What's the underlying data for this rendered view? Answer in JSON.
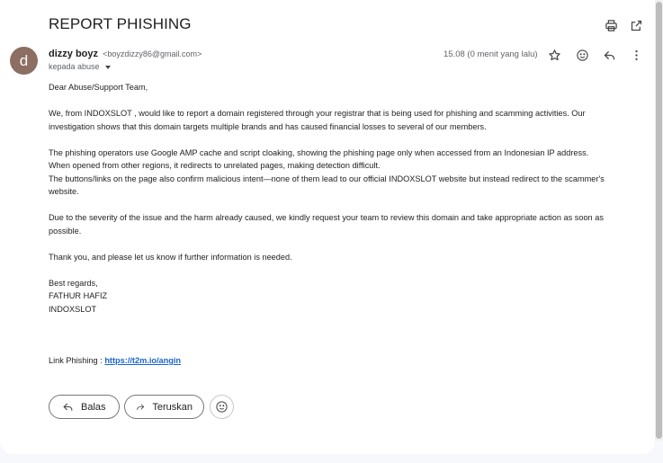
{
  "email": {
    "subject": "REPORT PHISHING",
    "sender": {
      "avatar_letter": "d",
      "name": "dizzy boyz",
      "email": "<boyzdizzy86@gmail.com>",
      "to_label": "kepada abuse"
    },
    "timestamp": "15.08 (0 menit yang lalu)",
    "body": {
      "greeting": "Dear Abuse/Support Team,",
      "p1": [
        "We, from INDOXSLOT , would like to report a domain registered through your registrar that is being used for phishing and scamming activities. Our",
        "investigation shows that this domain targets multiple brands and has caused financial losses to several of our members."
      ],
      "p2": [
        "The phishing operators use Google AMP cache and script cloaking, showing the phishing page only when accessed from an Indonesian IP address.",
        "When opened from other regions, it redirects to unrelated pages, making detection difficult.",
        "The buttons/links on the page also confirm malicious intent—none of them lead to our official INDOXSLOT website but instead redirect to the scammer's",
        "website."
      ],
      "p3": [
        "Due to the severity of the issue and the harm already caused, we kindly request your team to review this domain and take appropriate action as soon as",
        "possible."
      ],
      "p4": "Thank you, and please let us know if further information is needed.",
      "closing": [
        "Best regards,",
        "FATHUR HAFIZ",
        "INDOXSLOT"
      ],
      "link_label": "Link Phishing : ",
      "link_url": "https://t2m.io/angin"
    }
  },
  "actions": {
    "reply_label": "Balas",
    "forward_label": "Teruskan"
  },
  "icons": {
    "print": "print-icon",
    "open_new_window": "open-in-new-icon",
    "star": "star-icon",
    "emoji": "emoji-icon",
    "reply": "reply-icon",
    "more": "more-vert-icon",
    "forward": "forward-icon"
  },
  "colors": {
    "avatar": "#8d6e63",
    "link": "#1a66c9"
  }
}
